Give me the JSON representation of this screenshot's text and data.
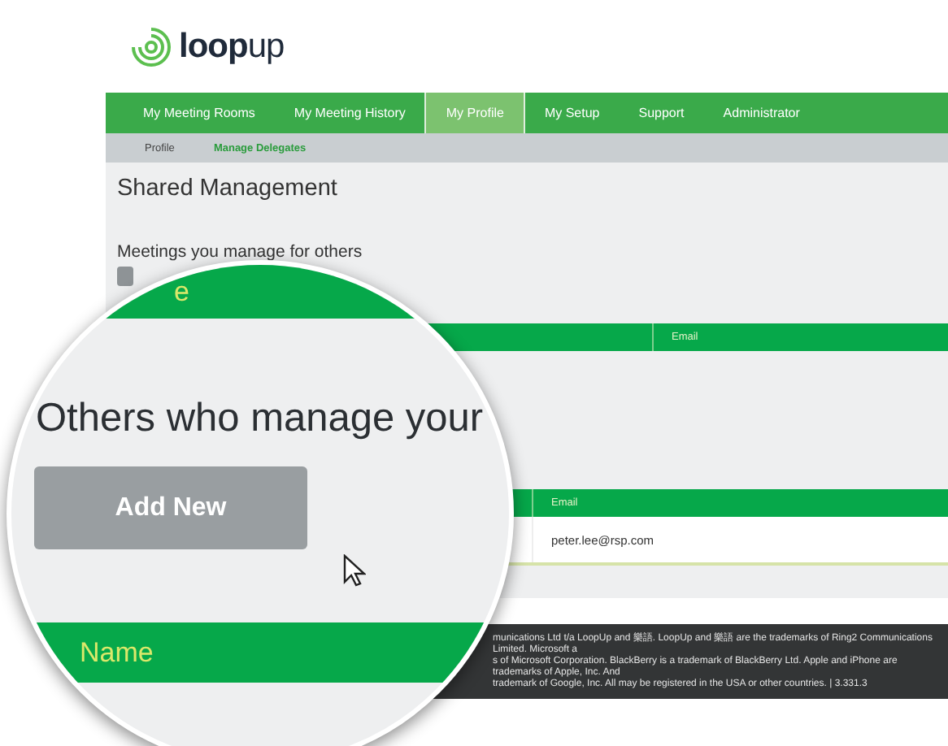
{
  "logo": {
    "text": "**loop**up"
  },
  "nav": {
    "tabs": [
      {
        "label": "My Meeting Rooms",
        "selected": false
      },
      {
        "label": "My Meeting History",
        "selected": false
      },
      {
        "label": "My Profile",
        "selected": true
      },
      {
        "label": "My Setup",
        "selected": false
      },
      {
        "label": "Support",
        "selected": false
      },
      {
        "label": "Administrator",
        "selected": false
      }
    ]
  },
  "subnav": {
    "items": [
      {
        "label": "Profile",
        "selected": false
      },
      {
        "label": "Manage Delegates",
        "selected": true
      }
    ]
  },
  "page": {
    "title": "Shared Management",
    "sections": [
      {
        "heading": "Meetings you manage for others",
        "columns": [
          "Email"
        ]
      },
      {
        "columns": [
          "Email"
        ],
        "rows": [
          [
            "peter.lee@rsp.com"
          ]
        ]
      }
    ]
  },
  "footer": {
    "lines": [
      "munications Ltd t/a LoopUp and 樂語. LoopUp and 樂語 are the trademarks of Ring2 Communications Limited. Microsoft a",
      "s of Microsoft Corporation. BlackBerry is a trademark of BlackBerry Ltd. Apple and iPhone are trademarks of Apple, Inc. And",
      "trademark of Google, Inc. All may be registered in the USA or other countries. | 3.331.3"
    ]
  },
  "magnifier": {
    "header_fragment": "e",
    "heading": "Others who manage your",
    "button": "Add New",
    "column": "Name"
  }
}
